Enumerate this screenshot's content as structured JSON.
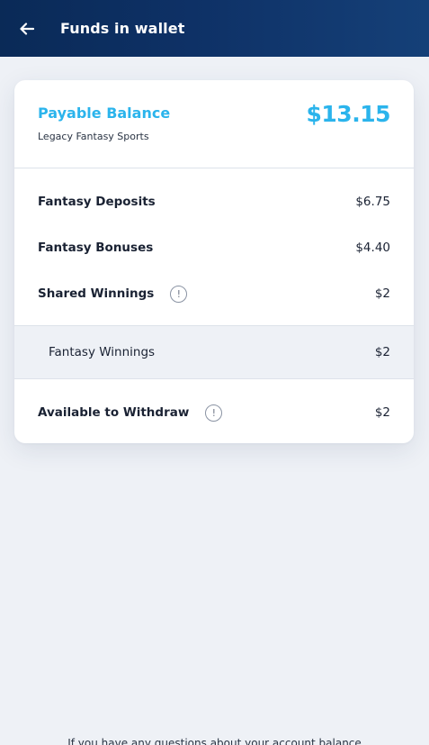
{
  "header": {
    "title": "Funds in wallet",
    "back_icon": "arrow-left-icon"
  },
  "balance": {
    "label": "Payable Balance",
    "subtitle": "Legacy Fantasy Sports",
    "amount": "$13.15"
  },
  "rows": [
    {
      "label": "Fantasy Deposits",
      "value": "$6.75"
    },
    {
      "label": "Fantasy Bonuses",
      "value": "$4.40"
    },
    {
      "label": "Shared Winnings",
      "value": "$2",
      "info_icon": "info-icon"
    }
  ],
  "sub_row": {
    "label": "Fantasy Winnings",
    "value": "$2"
  },
  "withdraw": {
    "label": "Available to Withdraw",
    "value": "$2",
    "info_icon": "info-icon"
  },
  "footer": {
    "text": "If you have any questions about your account balance"
  },
  "colors": {
    "header_bg": "#0e3166",
    "accent": "#2bb4ec",
    "page_bg": "#eef1f6",
    "card_bg": "#ffffff"
  }
}
